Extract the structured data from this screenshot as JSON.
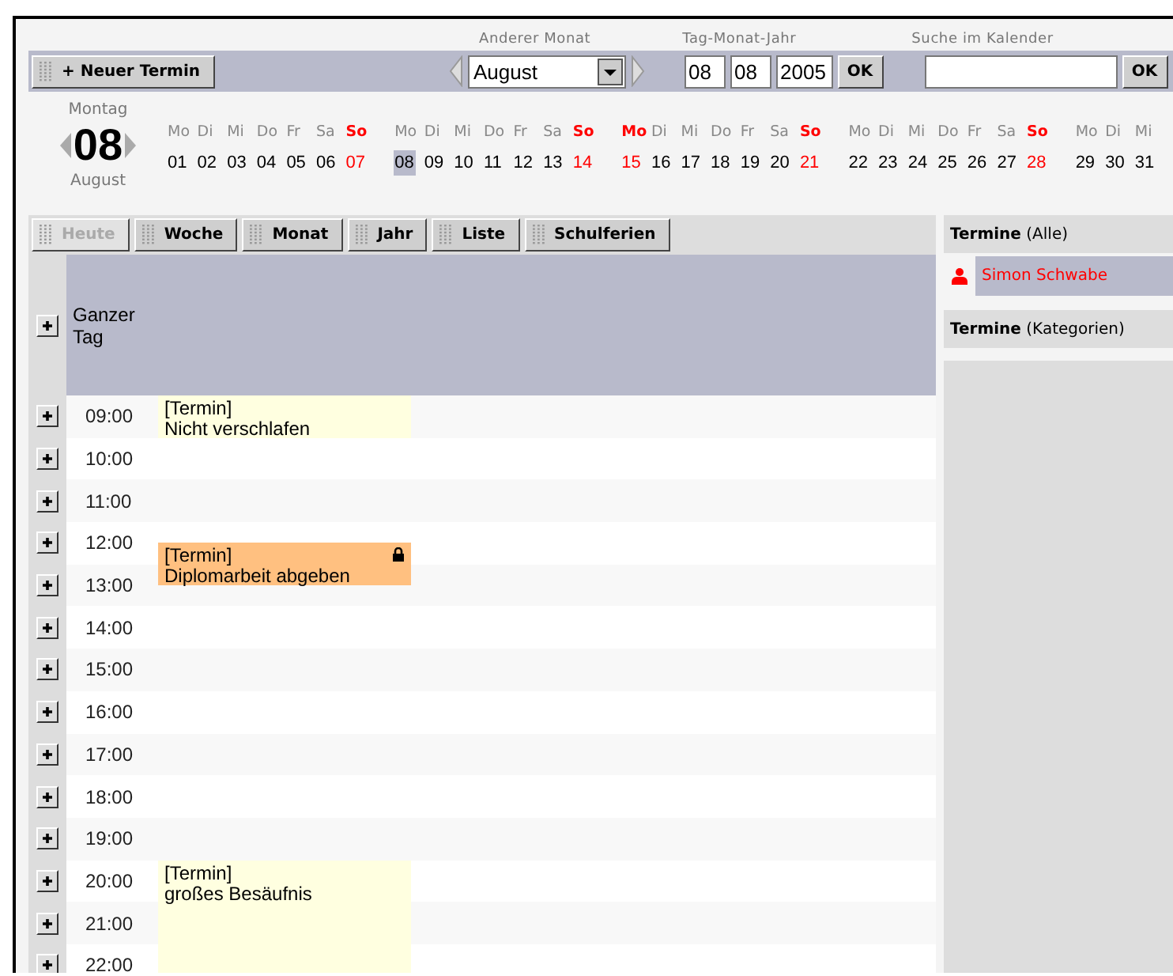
{
  "toolbar": {
    "new_button": "+ Neuer Termin",
    "month_label": "Anderer Monat",
    "month_value": "August",
    "date_label": "Tag-Monat-Jahr",
    "day": "08",
    "month": "08",
    "year": "2005",
    "date_ok": "OK",
    "search_label": "Suche im Kalender",
    "search_ok": "OK"
  },
  "current": {
    "weekday": "Montag",
    "day": "08",
    "month": "August"
  },
  "weeks": [
    {
      "days": [
        {
          "name": "Mo",
          "day": "01",
          "red": false,
          "selected": false
        },
        {
          "name": "Di",
          "day": "02",
          "red": false,
          "selected": false
        },
        {
          "name": "Mi",
          "day": "03",
          "red": false,
          "selected": false
        },
        {
          "name": "Do",
          "day": "04",
          "red": false,
          "selected": false
        },
        {
          "name": "Fr",
          "day": "05",
          "red": false,
          "selected": false
        },
        {
          "name": "Sa",
          "day": "06",
          "red": false,
          "selected": false
        },
        {
          "name": "So",
          "day": "07",
          "red": true,
          "selected": false
        }
      ]
    },
    {
      "days": [
        {
          "name": "Mo",
          "day": "08",
          "red": false,
          "selected": true
        },
        {
          "name": "Di",
          "day": "09",
          "red": false,
          "selected": false
        },
        {
          "name": "Mi",
          "day": "10",
          "red": false,
          "selected": false
        },
        {
          "name": "Do",
          "day": "11",
          "red": false,
          "selected": false
        },
        {
          "name": "Fr",
          "day": "12",
          "red": false,
          "selected": false
        },
        {
          "name": "Sa",
          "day": "13",
          "red": false,
          "selected": false
        },
        {
          "name": "So",
          "day": "14",
          "red": true,
          "selected": false
        }
      ]
    },
    {
      "days": [
        {
          "name": "Mo",
          "day": "15",
          "red": true,
          "selected": false
        },
        {
          "name": "Di",
          "day": "16",
          "red": false,
          "selected": false
        },
        {
          "name": "Mi",
          "day": "17",
          "red": false,
          "selected": false
        },
        {
          "name": "Do",
          "day": "18",
          "red": false,
          "selected": false
        },
        {
          "name": "Fr",
          "day": "19",
          "red": false,
          "selected": false
        },
        {
          "name": "Sa",
          "day": "20",
          "red": false,
          "selected": false
        },
        {
          "name": "So",
          "day": "21",
          "red": true,
          "selected": false
        }
      ]
    },
    {
      "days": [
        {
          "name": "Mo",
          "day": "22",
          "red": false,
          "selected": false
        },
        {
          "name": "Di",
          "day": "23",
          "red": false,
          "selected": false
        },
        {
          "name": "Mi",
          "day": "24",
          "red": false,
          "selected": false
        },
        {
          "name": "Do",
          "day": "25",
          "red": false,
          "selected": false
        },
        {
          "name": "Fr",
          "day": "26",
          "red": false,
          "selected": false
        },
        {
          "name": "Sa",
          "day": "27",
          "red": false,
          "selected": false
        },
        {
          "name": "So",
          "day": "28",
          "red": true,
          "selected": false
        }
      ]
    },
    {
      "days": [
        {
          "name": "Mo",
          "day": "29",
          "red": false,
          "selected": false
        },
        {
          "name": "Di",
          "day": "30",
          "red": false,
          "selected": false
        },
        {
          "name": "Mi",
          "day": "31",
          "red": false,
          "selected": false
        }
      ]
    }
  ],
  "views": [
    {
      "label": "Heute",
      "disabled": true
    },
    {
      "label": "Woche",
      "disabled": false
    },
    {
      "label": "Monat",
      "disabled": false
    },
    {
      "label": "Jahr",
      "disabled": false
    },
    {
      "label": "Liste",
      "disabled": false
    },
    {
      "label": "Schulferien",
      "disabled": false
    }
  ],
  "all_day": {
    "label": "Ganzer Tag"
  },
  "hours": [
    {
      "time": "09:00",
      "first_half_booked": true,
      "second_half_booked": true,
      "event": {
        "tag": "[Termin]",
        "title": "Nicht verschlafen",
        "locked": false,
        "color": "#ffffe0"
      }
    },
    {
      "time": "10:00",
      "first_half_booked": false,
      "second_half_booked": false
    },
    {
      "time": "11:00",
      "first_half_booked": false,
      "second_half_booked": false
    },
    {
      "time": "12:00",
      "first_half_booked": false,
      "second_half_booked": true,
      "event": {
        "tag": "[Termin]",
        "title": "Diplomarbeit abgeben",
        "locked": true,
        "color": "#ffc080"
      }
    },
    {
      "time": "13:00",
      "first_half_booked": true,
      "second_half_booked": false
    },
    {
      "time": "14:00",
      "first_half_booked": false,
      "second_half_booked": false
    },
    {
      "time": "15:00",
      "first_half_booked": false,
      "second_half_booked": false
    },
    {
      "time": "16:00",
      "first_half_booked": false,
      "second_half_booked": false
    },
    {
      "time": "17:00",
      "first_half_booked": false,
      "second_half_booked": false
    },
    {
      "time": "18:00",
      "first_half_booked": false,
      "second_half_booked": false
    },
    {
      "time": "19:00",
      "first_half_booked": false,
      "second_half_booked": false
    },
    {
      "time": "20:00",
      "first_half_booked": true,
      "second_half_booked": true,
      "event": {
        "tag": "[Termin]",
        "title": "großes Besäufnis",
        "locked": false,
        "color": "#ffffe0"
      }
    },
    {
      "time": "21:00",
      "first_half_booked": true,
      "second_half_booked": true
    },
    {
      "time": "22:00",
      "first_half_booked": true,
      "second_half_booked": true
    }
  ],
  "sidebar": {
    "all_title": "Termine",
    "all_note": "(Alle)",
    "people": [
      {
        "name": "Simon Schwabe",
        "color": "#ff0000"
      }
    ],
    "cat_title": "Termine",
    "cat_note": "(Kategorien)"
  }
}
